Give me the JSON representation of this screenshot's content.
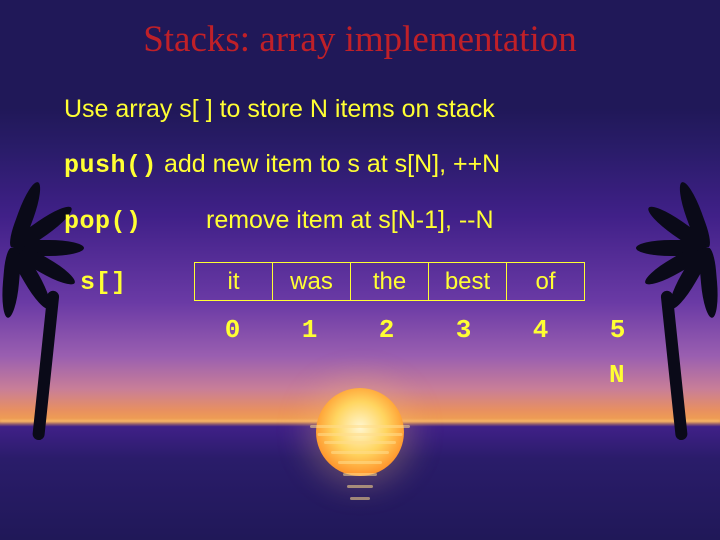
{
  "title": "Stacks: array implementation",
  "line_use": "Use array s[ ] to store N items on stack",
  "push_fn": "push()",
  "push_desc": " add new item to s at s[N], ++N",
  "pop_fn": "pop()",
  "pop_desc": "remove item at s[N-1], --N",
  "array_label": "s[]",
  "cells": [
    "it",
    "was",
    "the",
    "best",
    "of"
  ],
  "indices": [
    "0",
    "1",
    "2",
    "3",
    "4",
    "5"
  ],
  "N_label": "N"
}
